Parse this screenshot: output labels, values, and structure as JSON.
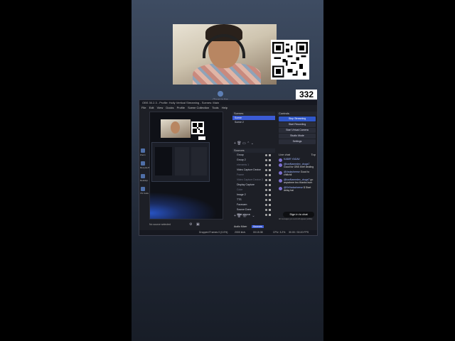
{
  "counter": "332",
  "app": {
    "brand": "Ghost in the Machine",
    "window_title": "OBS 30.2.3 - Profile: Holly Vertical Streaming - Scenes: Main",
    "menu": [
      "File",
      "Edit",
      "View",
      "Docks",
      "Profile",
      "Scene Collection",
      "Tools",
      "Help"
    ]
  },
  "preview": {
    "desktop_icons": [
      "Zoom",
      "Recycle Bin",
      "Desktop",
      "VS Code"
    ]
  },
  "scenes": {
    "header": "Scenes",
    "items": [
      "Scene",
      "Scene 2"
    ]
  },
  "sources": {
    "header": "Sources",
    "items": [
      {
        "label": "Group",
        "dim": false
      },
      {
        "label": "Group 2",
        "dim": false
      },
      {
        "label": "elements 1",
        "dim": true
      },
      {
        "label": "Video Capture Device",
        "dim": false
      },
      {
        "label": "Frame",
        "dim": true
      },
      {
        "label": "Video Capture Device 2",
        "dim": true
      },
      {
        "label": "Display Capture",
        "dim": false
      },
      {
        "label": "Color",
        "dim": true
      },
      {
        "label": "Image 2",
        "dim": false
      },
      {
        "label": "TTS",
        "dim": false
      },
      {
        "label": "Facecam",
        "dim": false
      },
      {
        "label": "Source Done",
        "dim": false
      },
      {
        "label": "Chat source",
        "dim": false
      }
    ],
    "tabs": [
      "Audio Mixer",
      "Sources"
    ]
  },
  "controls": {
    "header": "Controls",
    "buttons": [
      {
        "label": "Stop Streaming",
        "primary": true
      },
      {
        "label": "Start Recording",
        "primary": false
      },
      {
        "label": "Start Virtual Camera",
        "primary": false
      },
      {
        "label": "Studio Mode",
        "primary": false
      },
      {
        "label": "Settings",
        "primary": false
      }
    ]
  },
  "chat": {
    "header": "Live chat",
    "top": "Top",
    "messages": [
      {
        "name": "KABIR YADAV",
        "text": ""
      },
      {
        "name": "@lowNamedev_drugs7",
        "text": "Good for OBS brief dealing"
      },
      {
        "name": "@Vadacheese",
        "text": "Good to chillchil"
      },
      {
        "name": "@lowNamedev_drugs7",
        "text": "go anywhere bro thanks bum"
      },
      {
        "name": "@SriVadacheese",
        "text": "$ Start delay bai"
      }
    ],
    "signin": "Sign in to chat",
    "note": "All messages you send will appear publicly"
  },
  "status": {
    "no_source": "No source selected",
    "dropped": "Dropped Frames 0 (0.0%)",
    "kbps": "2000 kb/s",
    "time": "00:15:38",
    "cpu": "CPU: 3.2%",
    "fps": "30.00 / 30.00 FPS"
  }
}
